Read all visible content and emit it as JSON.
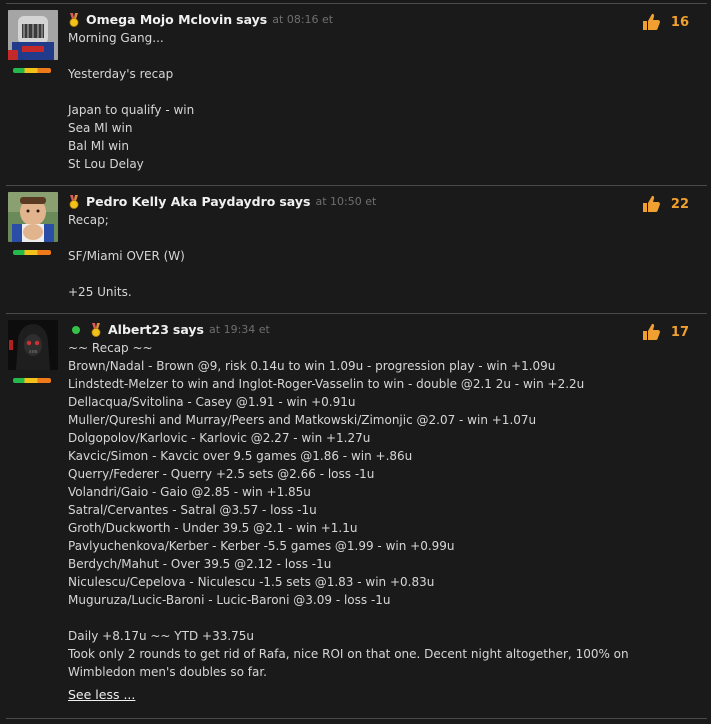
{
  "posts": [
    {
      "author": "Omega Mojo Mclovin",
      "says": "says",
      "at_time": "at 08:16 et",
      "likes": "16",
      "online": false,
      "lines": [
        "Morning Gang...",
        "",
        "Yesterday's recap",
        "",
        "Japan to qualify - win",
        "Sea Ml win",
        "Bal Ml win",
        "St Lou Delay"
      ]
    },
    {
      "author": "Pedro Kelly Aka Paydaydro",
      "says": "says",
      "at_time": "at 10:50 et",
      "likes": "22",
      "online": false,
      "lines": [
        "Recap;",
        "",
        "SF/Miami OVER (W)",
        "",
        "+25 Units."
      ]
    },
    {
      "author": "Albert23",
      "says": "says",
      "at_time": "at 19:34 et",
      "likes": "17",
      "online": true,
      "lines": [
        "~~ Recap ~~",
        "Brown/Nadal - Brown @9, risk 0.14u to win 1.09u - progression play - win +1.09u",
        "Lindstedt-Melzer to win and Inglot-Roger-Vasselin to win - double @2.1 2u - win +2.2u",
        "Dellacqua/Svitolina - Casey @1.91 - win +0.91u",
        "Muller/Qureshi and Murray/Peers and Matkowski/Zimonjic @2.07 - win +1.07u",
        "Dolgopolov/Karlovic - Karlovic @2.27 - win +1.27u",
        "Kavcic/Simon - Kavcic over 9.5 games @1.86 - win +.86u",
        "Querry/Federer - Querry +2.5 sets @2.66 - loss -1u",
        "Volandri/Gaio - Gaio @2.85 - win +1.85u",
        "Satral/Cervantes - Satral @3.57 - loss -1u",
        "Groth/Duckworth - Under 39.5 @2.1 - win +1.1u",
        "Pavlyuchenkova/Kerber - Kerber -5.5 games @1.99 - win +0.99u",
        "Berdych/Mahut - Over 39.5 @2.12 - loss -1u",
        "Niculescu/Cepelova - Niculescu -1.5 sets @1.83 - win +0.83u",
        "Muguruza/Lucic-Baroni - Lucic-Baroni @3.09 - loss -1u",
        "",
        "Daily +8.17u ~~ YTD +33.75u",
        "Took only 2 rounds to get rid of Rafa, nice ROI on that one. Decent night altogether, 100% on",
        "Wimbledon men's doubles so far."
      ],
      "see_less": "See less ..."
    }
  ],
  "colors": {
    "background": "#1a1a1a",
    "text": "#d6d6d6",
    "author": "#f0f0f0",
    "timestamp": "#6e6e6e",
    "like_count": "#f0a030",
    "online_dot": "#36c24a",
    "separator": "#4a4a4a"
  },
  "icons": {
    "like": "thumbs-up-icon",
    "badge": "medal-badge-icon",
    "online": "online-status-dot"
  }
}
